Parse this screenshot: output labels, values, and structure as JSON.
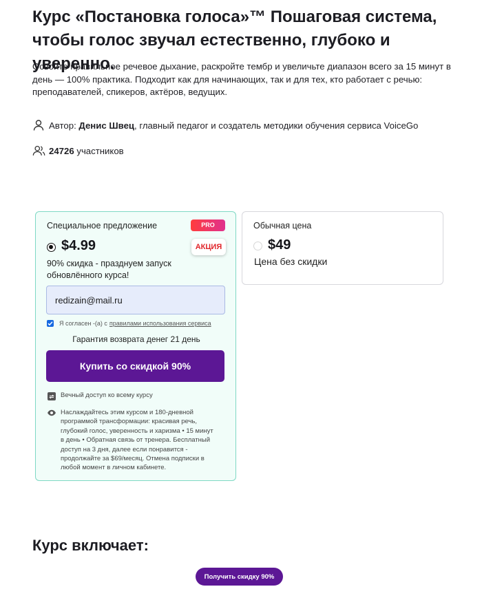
{
  "course": {
    "title": "Курс «Постановка голоса»™ Пошаговая система, чтобы голос звучал естественно, глубоко и уверенно.",
    "intro": "Освойте правильное речевое дыхание, раскройте тембр и увеличьте диапазон всего за 15 минут в день — 100% практика.  Подходит как для начинающих, так и для тех, кто работает с речью: преподавателей, спикеров, актёров, ведущих.",
    "author_prefix": "Автор:",
    "author_name": "Денис Швец",
    "author_suffix": ", главный педагог и создатель методики обучения сервиса VoiceGo",
    "participants_count": "24726",
    "participants_label": "участников"
  },
  "special_offer": {
    "label": "Специальное предложение",
    "pro_badge": "PRO",
    "sale_badge": "АКЦИЯ",
    "price": "$4.99",
    "discount_text": "90% скидка - празднуем запуск обновлённого курса!",
    "email_value": "redizain@mail.ru",
    "agree_prefix": "Я согласен -(а) с",
    "agree_link": "правилами использования сервиса",
    "agree_checked": true,
    "guarantee": "Гарантия возврата денег 21 день",
    "buy_button": "Купить со скидкой 90%",
    "feature_access": "Вечный доступ ко всему курсу",
    "feature_program": "Наслаждайтесь этим курсом и 180-дневной программой трансформации: красивая речь, глубокий голос, уверенность и харизма • 15 минут в день • Обратная связь от тренера. Бесплатный доступ на 3 дня, далее если понравится - продолжайте за $69/месяц. Отмена подписки в любой момент в личном кабинете.",
    "selected": true
  },
  "regular_offer": {
    "label": "Обычная цена",
    "price": "$49",
    "description": "Цена без скидки",
    "selected": false
  },
  "includes": {
    "title": "Курс включает:",
    "cta": "Получить скидку 90%"
  },
  "colors": {
    "accent_purple": "#5c1795",
    "special_card_bg": "#f1fdf9",
    "special_card_border": "#7ed8c4",
    "sale_red": "#e0252a",
    "checkbox_blue": "#1769e0"
  },
  "icons": {
    "author": "user-icon",
    "participants": "users-icon",
    "access": "refresh-icon",
    "program": "eye-icon"
  }
}
